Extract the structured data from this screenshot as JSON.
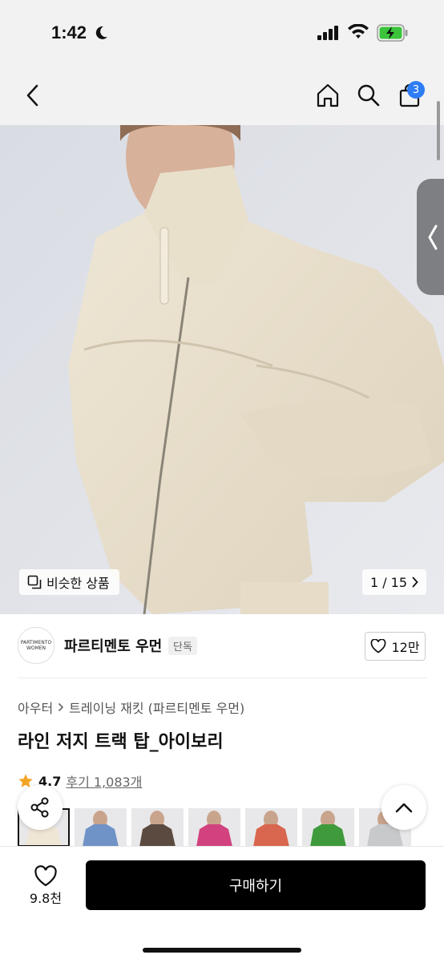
{
  "status": {
    "time": "1:42"
  },
  "header": {
    "cart_count": "3"
  },
  "gallery": {
    "similar_label": "비슷한 상품",
    "counter": "1 / 15"
  },
  "brand": {
    "name": "파르티멘토 우먼",
    "logo_line1": "PARTIMENTO",
    "logo_line2": "WOMEN",
    "exclusive_badge": "단독",
    "likes": "12만"
  },
  "breadcrumb": {
    "category": "아우터",
    "subcategory": "트레이닝 재킷 (파르티멘토 우먼)"
  },
  "product": {
    "title": "라인 저지 트랙 탑_아이보리",
    "rating": "4.7",
    "reviews": "후기 1,083개"
  },
  "thumbnails": [
    {
      "color": "#efe6d6"
    },
    {
      "color": "#6f92c7"
    },
    {
      "color": "#5b4a3f"
    },
    {
      "color": "#d2427e"
    },
    {
      "color": "#d9664e"
    },
    {
      "color": "#3f9a3b"
    },
    {
      "color": "#c7c9cb"
    }
  ],
  "bottom": {
    "wish_count": "9.8천",
    "buy_label": "구매하기"
  },
  "colors": {
    "accent": "#2f7df6",
    "star": "#f4a425",
    "buy_bg": "#000000"
  }
}
